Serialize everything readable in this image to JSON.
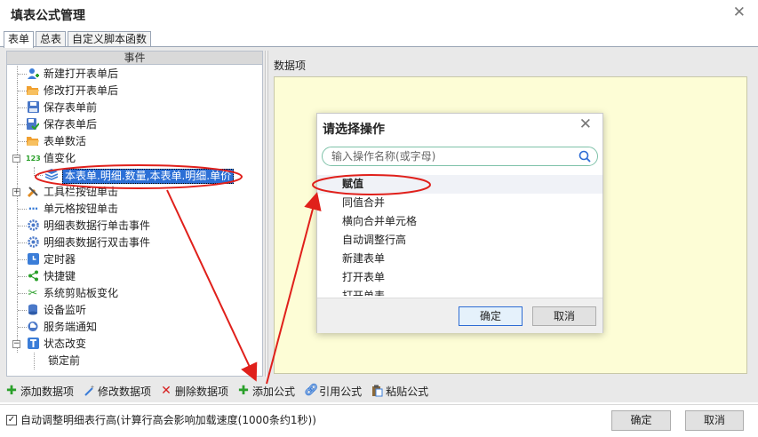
{
  "window": {
    "title": "填表公式管理",
    "close_glyph": "✕"
  },
  "tabs": [
    {
      "label": "表单",
      "active": true
    },
    {
      "label": "总表",
      "active": false
    },
    {
      "label": "自定义脚本函数",
      "active": false
    }
  ],
  "events_panel": {
    "header": "事件",
    "items": [
      {
        "label": "新建打开表单后",
        "icon": "user-add-icon"
      },
      {
        "label": "修改打开表单后",
        "icon": "folder-open-icon"
      },
      {
        "label": "保存表单前",
        "icon": "save-icon"
      },
      {
        "label": "保存表单后",
        "icon": "save-check-icon"
      },
      {
        "label": "表单数活",
        "icon": "folder-open-icon"
      },
      {
        "label": "值变化",
        "icon": "number-123-icon",
        "expander": "−"
      },
      {
        "label": "本表单.明细.数量,本表单.明细.单价",
        "icon": "layers-icon",
        "child": true,
        "selected": true
      },
      {
        "label": "工具栏按钮单击",
        "icon": "tools-icon",
        "expander": "+"
      },
      {
        "label": "单元格按钮单击",
        "icon": "dots-icon"
      },
      {
        "label": "明细表数据行单击事件",
        "icon": "gear-blue-icon"
      },
      {
        "label": "明细表数据行双击事件",
        "icon": "gear-blue-icon"
      },
      {
        "label": "定时器",
        "icon": "timer-icon"
      },
      {
        "label": "快捷键",
        "icon": "share-icon"
      },
      {
        "label": "系统剪贴板变化",
        "icon": "scissors-icon"
      },
      {
        "label": "设备监听",
        "icon": "database-icon"
      },
      {
        "label": "服务端通知",
        "icon": "cloud-icon"
      },
      {
        "label": "状态改变",
        "icon": "text-t-icon",
        "expander": "−"
      },
      {
        "label": "锁定前",
        "icon": "",
        "deep": true
      }
    ]
  },
  "data_panel": {
    "label": "数据项"
  },
  "toolbar": {
    "add_data": "添加数据项",
    "edit_data": "修改数据项",
    "delete_data": "删除数据项",
    "add_formula": "添加公式",
    "ref_formula": "引用公式",
    "paste_formula": "粘贴公式"
  },
  "footer": {
    "auto_height_label": "自动调整明细表行高(计算行高会影响加载速度(1000条约1秒))",
    "auto_height_checked": true,
    "ok": "确定",
    "cancel": "取消"
  },
  "dialog": {
    "title": "请选择操作",
    "close_glyph": "✕",
    "search_placeholder": "输入操作名称(或字母)",
    "items": [
      "赋值",
      "同值合并",
      "横向合并单元格",
      "自动调整行高",
      "新建表单",
      "打开表单",
      "打开单表"
    ],
    "highlighted_index": 0,
    "ok": "确定",
    "cancel": "取消"
  },
  "colors": {
    "accent": "#2b6fd6",
    "annotation": "#e0201b",
    "data_area_bg": "#fdfdd6"
  }
}
